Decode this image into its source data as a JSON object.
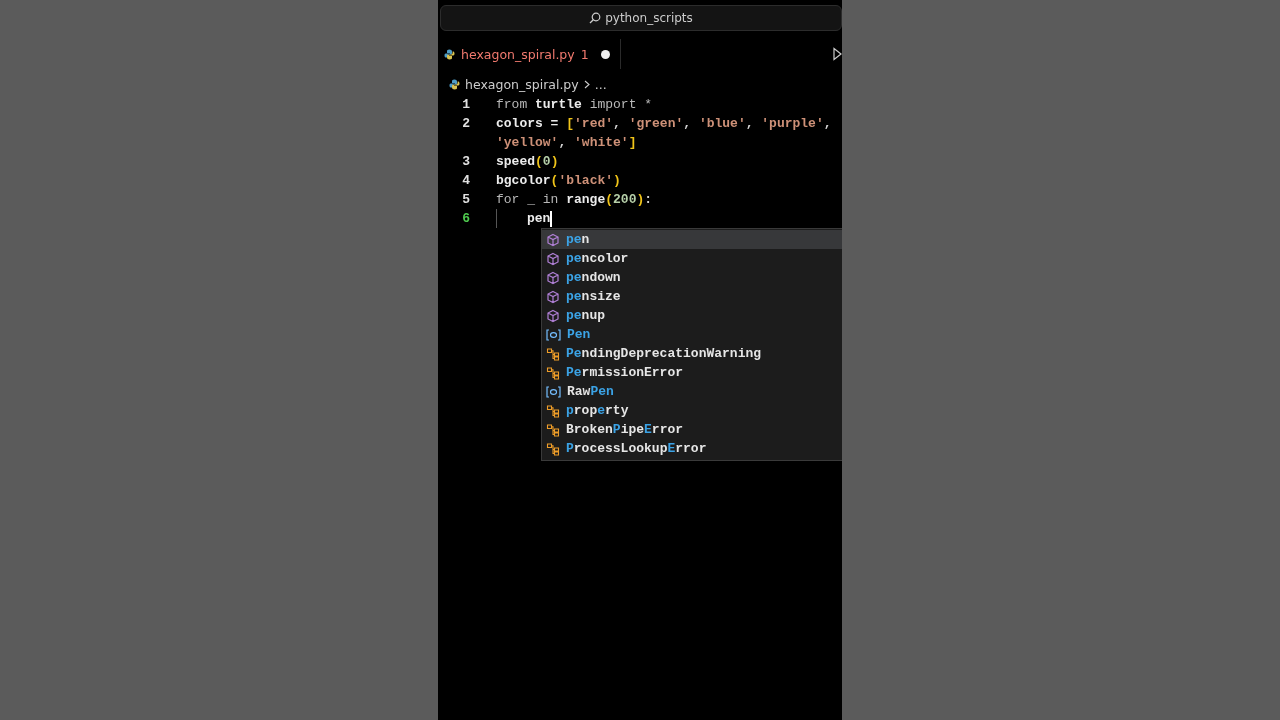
{
  "search": {
    "text": "python_scripts"
  },
  "tab": {
    "label": "hexagon_spiral.py",
    "problems": "1",
    "modified": true
  },
  "breadcrumb": [
    "hexagon_spiral.py",
    "..."
  ],
  "lines": [
    {
      "number": "1",
      "active": false,
      "tokens": [
        {
          "kind": "kw",
          "text": "from "
        },
        {
          "kind": "fn",
          "text": "turtle"
        },
        {
          "kind": "kw",
          "text": " import *"
        }
      ]
    },
    {
      "number": "2",
      "active": false,
      "tokens": [
        {
          "kind": "fn",
          "text": "colors = "
        },
        {
          "kind": "br",
          "text": "["
        },
        {
          "kind": "str",
          "text": "'red'"
        },
        {
          "kind": "op",
          "text": ", "
        },
        {
          "kind": "str",
          "text": "'green'"
        },
        {
          "kind": "op",
          "text": ", "
        },
        {
          "kind": "str",
          "text": "'blue'"
        },
        {
          "kind": "op",
          "text": ", "
        },
        {
          "kind": "str",
          "text": "'purple'"
        },
        {
          "kind": "op",
          "text": ", "
        },
        {
          "kind": "str",
          "text": "'yellow'"
        },
        {
          "kind": "op",
          "text": ", "
        },
        {
          "kind": "str",
          "text": "'white'"
        },
        {
          "kind": "br",
          "text": "]"
        }
      ]
    },
    {
      "number": "3",
      "active": false,
      "tokens": [
        {
          "kind": "fn",
          "text": "speed"
        },
        {
          "kind": "br",
          "text": "("
        },
        {
          "kind": "num",
          "text": "0"
        },
        {
          "kind": "br",
          "text": ")"
        }
      ]
    },
    {
      "number": "4",
      "active": false,
      "tokens": [
        {
          "kind": "fn",
          "text": "bgcolor"
        },
        {
          "kind": "br",
          "text": "("
        },
        {
          "kind": "str",
          "text": "'black'"
        },
        {
          "kind": "br",
          "text": ")"
        }
      ]
    },
    {
      "number": "5",
      "active": false,
      "tokens": [
        {
          "kind": "kw",
          "text": "for _ in "
        },
        {
          "kind": "fn",
          "text": "range"
        },
        {
          "kind": "br",
          "text": "("
        },
        {
          "kind": "num",
          "text": "200"
        },
        {
          "kind": "br",
          "text": ")"
        },
        {
          "kind": "op",
          "text": ":"
        }
      ]
    },
    {
      "number": "6",
      "active": true,
      "indent": true,
      "tokens": [
        {
          "kind": "fn",
          "text": "pen"
        }
      ]
    }
  ],
  "suggestions": [
    {
      "kind": "method",
      "selected": true,
      "parts": [
        {
          "text": "pe",
          "match": true
        },
        {
          "text": "n",
          "match": false
        }
      ]
    },
    {
      "kind": "method",
      "selected": false,
      "parts": [
        {
          "text": "pe",
          "match": true
        },
        {
          "text": "ncolor",
          "match": false
        }
      ]
    },
    {
      "kind": "method",
      "selected": false,
      "parts": [
        {
          "text": "pe",
          "match": true
        },
        {
          "text": "ndown",
          "match": false
        }
      ]
    },
    {
      "kind": "method",
      "selected": false,
      "parts": [
        {
          "text": "pe",
          "match": true
        },
        {
          "text": "nsize",
          "match": false
        }
      ]
    },
    {
      "kind": "method",
      "selected": false,
      "parts": [
        {
          "text": "pe",
          "match": true
        },
        {
          "text": "nup",
          "match": false
        }
      ]
    },
    {
      "kind": "variable",
      "selected": false,
      "parts": [
        {
          "text": "Pen",
          "match": true
        }
      ]
    },
    {
      "kind": "class",
      "selected": false,
      "parts": [
        {
          "text": "Pe",
          "match": true
        },
        {
          "text": "ndingDeprecationWarning",
          "match": false
        }
      ]
    },
    {
      "kind": "class",
      "selected": false,
      "parts": [
        {
          "text": "Pe",
          "match": true
        },
        {
          "text": "rmissionError",
          "match": false
        }
      ]
    },
    {
      "kind": "variable",
      "selected": false,
      "parts": [
        {
          "text": "Raw",
          "match": false
        },
        {
          "text": "Pen",
          "match": true
        }
      ]
    },
    {
      "kind": "class",
      "selected": false,
      "parts": [
        {
          "text": "p",
          "match": true
        },
        {
          "text": "rop",
          "match": false
        },
        {
          "text": "e",
          "match": true
        },
        {
          "text": "rty",
          "match": false
        }
      ]
    },
    {
      "kind": "class",
      "selected": false,
      "parts": [
        {
          "text": "Broken",
          "match": false
        },
        {
          "text": "P",
          "match": true
        },
        {
          "text": "ipe",
          "match": false
        },
        {
          "text": "E",
          "match": true
        },
        {
          "text": "rror",
          "match": false
        }
      ]
    },
    {
      "kind": "class",
      "selected": false,
      "parts": [
        {
          "text": "P",
          "match": true
        },
        {
          "text": "rocessLookup",
          "match": false
        },
        {
          "text": "E",
          "match": true
        },
        {
          "text": "rror",
          "match": false
        }
      ]
    }
  ]
}
